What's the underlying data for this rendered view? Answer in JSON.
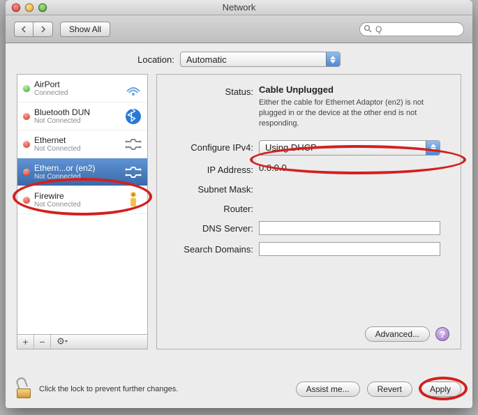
{
  "window": {
    "title": "Network"
  },
  "toolbar": {
    "show_all": "Show All",
    "search_placeholder": "Q"
  },
  "location": {
    "label": "Location:",
    "value": "Automatic"
  },
  "services": [
    {
      "name": "AirPort",
      "status": "Connected",
      "dot": "green",
      "icon": "airport"
    },
    {
      "name": "Bluetooth DUN",
      "status": "Not Connected",
      "dot": "red",
      "icon": "bluetooth"
    },
    {
      "name": "Ethernet",
      "status": "Not Connected",
      "dot": "red",
      "icon": "ethernet"
    },
    {
      "name": "Ethern...or (en2)",
      "status": "Not Connected",
      "dot": "red",
      "icon": "ethernet",
      "selected": true
    },
    {
      "name": "Firewire",
      "status": "Not Connected",
      "dot": "red",
      "icon": "firewire"
    }
  ],
  "detail": {
    "status_label": "Status:",
    "status_value": "Cable Unplugged",
    "status_desc": "Either the cable for Ethernet Adaptor (en2) is not plugged in or the device at the other end is not responding.",
    "config_label": "Configure IPv4:",
    "config_value": "Using DHCP",
    "ip_label": "IP Address:",
    "ip_value": "0.0.0.0",
    "subnet_label": "Subnet Mask:",
    "router_label": "Router:",
    "dns_label": "DNS Server:",
    "search_label": "Search Domains:",
    "advanced": "Advanced...",
    "help": "?"
  },
  "bottom": {
    "lock_text": "Click the lock to prevent further changes.",
    "assist": "Assist me...",
    "revert": "Revert",
    "apply": "Apply"
  }
}
